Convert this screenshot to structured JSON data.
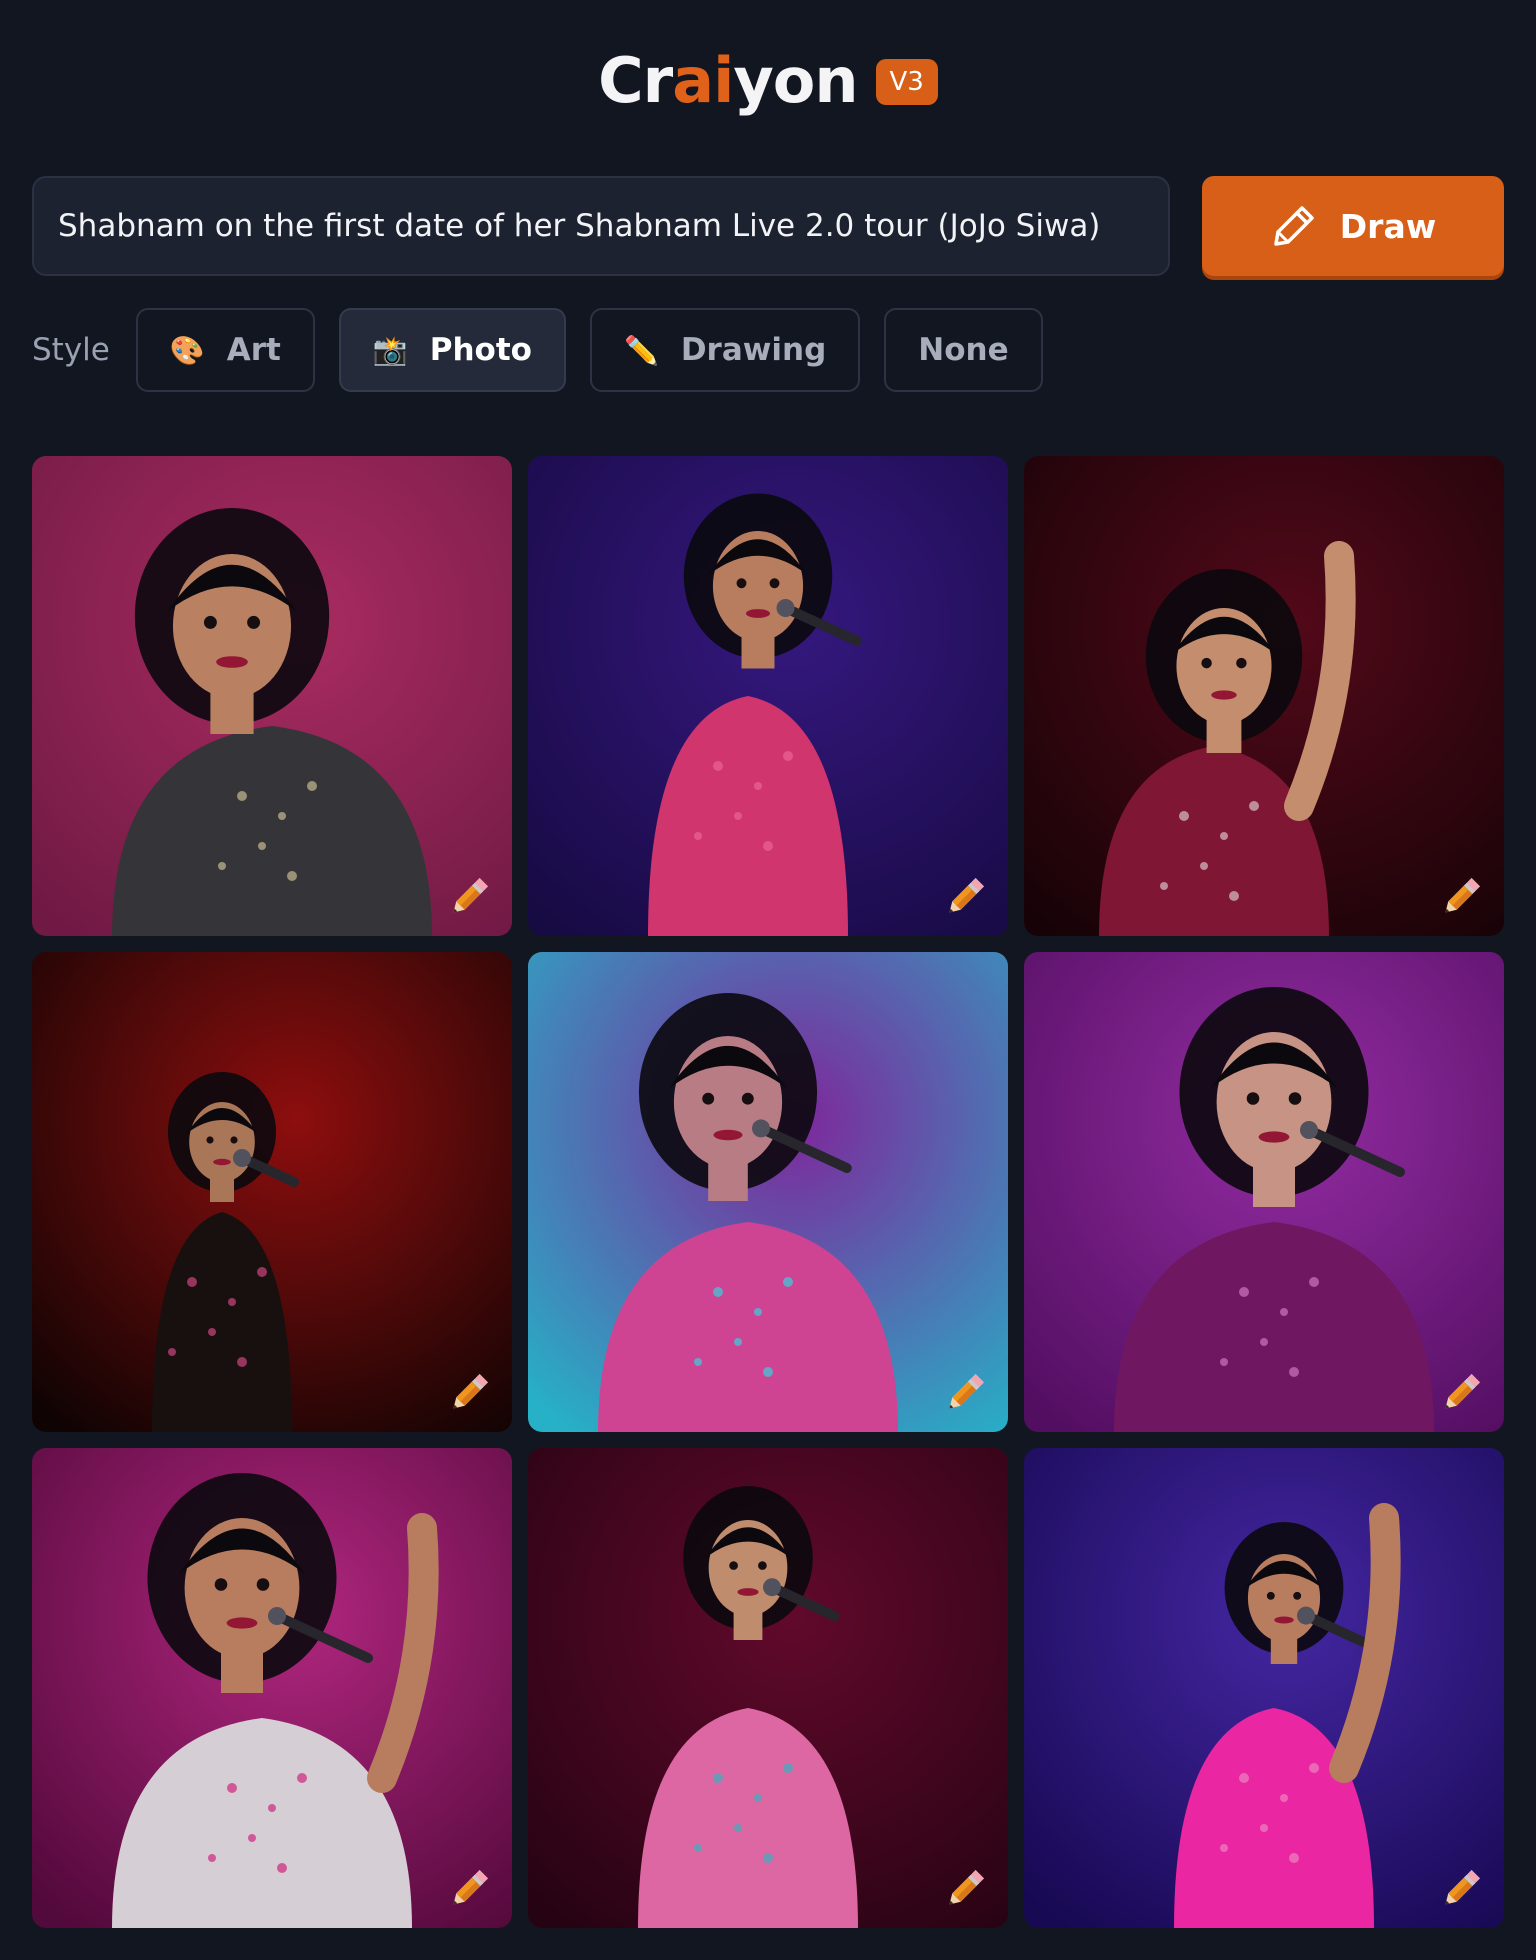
{
  "header": {
    "logo_pre": "Cr",
    "logo_ai": "ai",
    "logo_post": "yon",
    "version": "V3"
  },
  "prompt": {
    "value": "Shabnam on the first date of her Shabnam Live 2.0 tour (JoJo Siwa)"
  },
  "draw_button": {
    "label": "Draw",
    "icon": "pencil-icon"
  },
  "style": {
    "label": "Style",
    "options": [
      {
        "label": "Art",
        "icon": "🎨",
        "icon_name": "palette-icon",
        "active": false
      },
      {
        "label": "Photo",
        "icon": "📸",
        "icon_name": "camera-flash-icon",
        "active": true
      },
      {
        "label": "Drawing",
        "icon": "✏️",
        "icon_name": "pencil-icon",
        "active": false
      },
      {
        "label": "None",
        "icon": "",
        "active": false
      }
    ]
  },
  "images": [
    {
      "bg": [
        "#b8306a",
        "#7a1c4a"
      ],
      "outfit": "#3a3a3e",
      "accent": "#d9c9a0",
      "skin": "#c98d6b"
    },
    {
      "bg": [
        "#3a1a8a",
        "#1a0c4a"
      ],
      "outfit": "#e23a78",
      "accent": "#ff6fa0",
      "skin": "#c88866"
    },
    {
      "bg": [
        "#5a0a1c",
        "#1a0408"
      ],
      "outfit": "#8a1838",
      "accent": "#e8d0d8",
      "skin": "#d49a78"
    },
    {
      "bg": [
        "#9a1010",
        "#120404"
      ],
      "outfit": "#1a1210",
      "accent": "#e04a8a",
      "skin": "#b88060"
    },
    {
      "bg": [
        "#8a2aa8",
        "#2ac0d8"
      ],
      "outfit": "#e04aa0",
      "accent": "#40e0f0",
      "skin": "#c88890"
    },
    {
      "bg": [
        "#a030b0",
        "#5a106a"
      ],
      "outfit": "#7a1a6a",
      "accent": "#e080d0",
      "skin": "#d8a090"
    },
    {
      "bg": [
        "#c02a8a",
        "#5a0a40"
      ],
      "outfit": "#e8e0e8",
      "accent": "#e02a8a",
      "skin": "#c88868"
    },
    {
      "bg": [
        "#6a0a30",
        "#2a0414"
      ],
      "outfit": "#f070b0",
      "accent": "#40c0d0",
      "skin": "#d09878"
    },
    {
      "bg": [
        "#4a2ab0",
        "#1a0a5a"
      ],
      "outfit": "#ff2ab0",
      "accent": "#ff90d0",
      "skin": "#c88868"
    }
  ]
}
